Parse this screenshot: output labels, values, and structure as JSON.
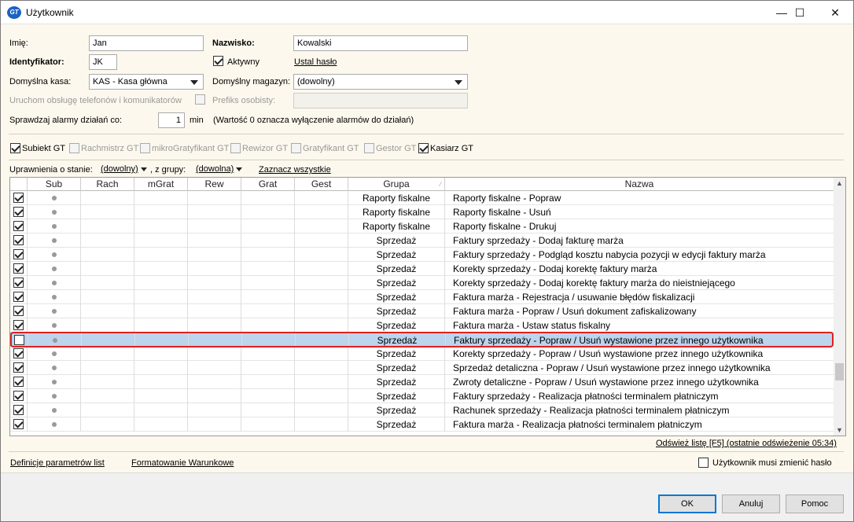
{
  "window": {
    "title": "Użytkownik",
    "app_icon_text": "GT",
    "minimize": "—",
    "maximize": "☐",
    "close": "✕"
  },
  "form": {
    "imie_label": "Imię:",
    "imie_value": "Jan",
    "nazwisko_label": "Nazwisko:",
    "nazwisko_value": "Kowalski",
    "identyfikator_label": "Identyfikator:",
    "identyfikator_value": "JK",
    "aktywny_label": "Aktywny",
    "aktywny_checked": true,
    "ustal_haslo": "Ustal hasło",
    "kasa_label": "Domyślna kasa:",
    "kasa_value": "KAS - Kasa główna",
    "magazyn_label": "Domyślny magazyn:",
    "magazyn_value": "(dowolny)",
    "telefony_label": "Uruchom obsługę telefonów i komunikatorów",
    "prefiks_label": "Prefiks osobisty:",
    "prefiks_value": "",
    "alarmy_label": "Sprawdzaj alarmy działań co:",
    "alarmy_value": "1",
    "alarmy_unit": "min",
    "alarmy_hint": "(Wartość 0 oznacza wyłączenie alarmów do działań)"
  },
  "permissions": [
    {
      "label": "Subiekt GT",
      "checked": true,
      "enabled": true
    },
    {
      "label": "Rachmistrz GT",
      "checked": false,
      "enabled": false
    },
    {
      "label": "mikroGratyfikant GT",
      "checked": false,
      "enabled": false
    },
    {
      "label": "Rewizor GT",
      "checked": false,
      "enabled": false
    },
    {
      "label": "Gratyfikant GT",
      "checked": false,
      "enabled": false
    },
    {
      "label": "Gestor GT",
      "checked": false,
      "enabled": false
    },
    {
      "label": "Kasiarz GT",
      "checked": true,
      "enabled": true
    }
  ],
  "filter": {
    "stan_label": "Uprawnienia o stanie:",
    "stan_value": "(dowolny)",
    "grupa_label": ", z grupy:",
    "grupa_value": "(dowolna)",
    "select_all": "Zaznacz wszystkie"
  },
  "grid": {
    "columns": [
      "",
      "Sub",
      "Rach",
      "mGrat",
      "Rew",
      "Grat",
      "Gest",
      "Grupa",
      "Nazwa"
    ],
    "sort_glyph": "⁄",
    "rows": [
      {
        "checked": true,
        "grupa": "Raporty fiskalne",
        "nazwa": "Raporty fiskalne - Popraw"
      },
      {
        "checked": true,
        "grupa": "Raporty fiskalne",
        "nazwa": "Raporty fiskalne - Usuń"
      },
      {
        "checked": true,
        "grupa": "Raporty fiskalne",
        "nazwa": "Raporty fiskalne - Drukuj"
      },
      {
        "checked": true,
        "grupa": "Sprzedaż",
        "nazwa": "Faktury sprzedaży - Dodaj fakturę marża"
      },
      {
        "checked": true,
        "grupa": "Sprzedaż",
        "nazwa": "Faktury sprzedaży - Podgląd kosztu nabycia pozycji w edycji faktury marża"
      },
      {
        "checked": true,
        "grupa": "Sprzedaż",
        "nazwa": "Korekty sprzedaży - Dodaj korektę faktury marża"
      },
      {
        "checked": true,
        "grupa": "Sprzedaż",
        "nazwa": "Korekty sprzedaży - Dodaj korektę faktury marża do nieistniejącego"
      },
      {
        "checked": true,
        "grupa": "Sprzedaż",
        "nazwa": "Faktura marża - Rejestracja / usuwanie błędów fiskalizacji"
      },
      {
        "checked": true,
        "grupa": "Sprzedaż",
        "nazwa": "Faktura marża - Popraw / Usuń dokument zafiskalizowany"
      },
      {
        "checked": true,
        "grupa": "Sprzedaż",
        "nazwa": "Faktura marża - Ustaw status fiskalny"
      },
      {
        "checked": false,
        "grupa": "Sprzedaż",
        "nazwa": "Faktury sprzedaży - Popraw / Usuń wystawione przez innego użytkownika",
        "selected": true
      },
      {
        "checked": true,
        "grupa": "Sprzedaż",
        "nazwa": "Korekty sprzedaży - Popraw / Usuń wystawione przez innego użytkownika"
      },
      {
        "checked": true,
        "grupa": "Sprzedaż",
        "nazwa": "Sprzedaż detaliczna - Popraw / Usuń wystawione przez innego użytkownika"
      },
      {
        "checked": true,
        "grupa": "Sprzedaż",
        "nazwa": "Zwroty detaliczne - Popraw / Usuń wystawione przez innego użytkownika"
      },
      {
        "checked": true,
        "grupa": "Sprzedaż",
        "nazwa": "Faktury sprzedaży - Realizacja płatności terminalem płatniczym"
      },
      {
        "checked": true,
        "grupa": "Sprzedaż",
        "nazwa": "Rachunek sprzedaży - Realizacja płatności terminalem płatniczym"
      },
      {
        "checked": true,
        "grupa": "Sprzedaż",
        "nazwa": "Faktura marża - Realizacja płatności terminalem płatniczym"
      }
    ]
  },
  "refresh_link": "Odśwież listę [F5] (ostatnie odświeżenie 05:34)",
  "footer": {
    "definicje": "Definicje parametrów list",
    "formatowanie": "Formatowanie Warunkowe",
    "zmien_haslo": "Użytkownik musi zmienić hasło",
    "ok": "OK",
    "anuluj": "Anuluj",
    "pomoc": "Pomoc"
  }
}
